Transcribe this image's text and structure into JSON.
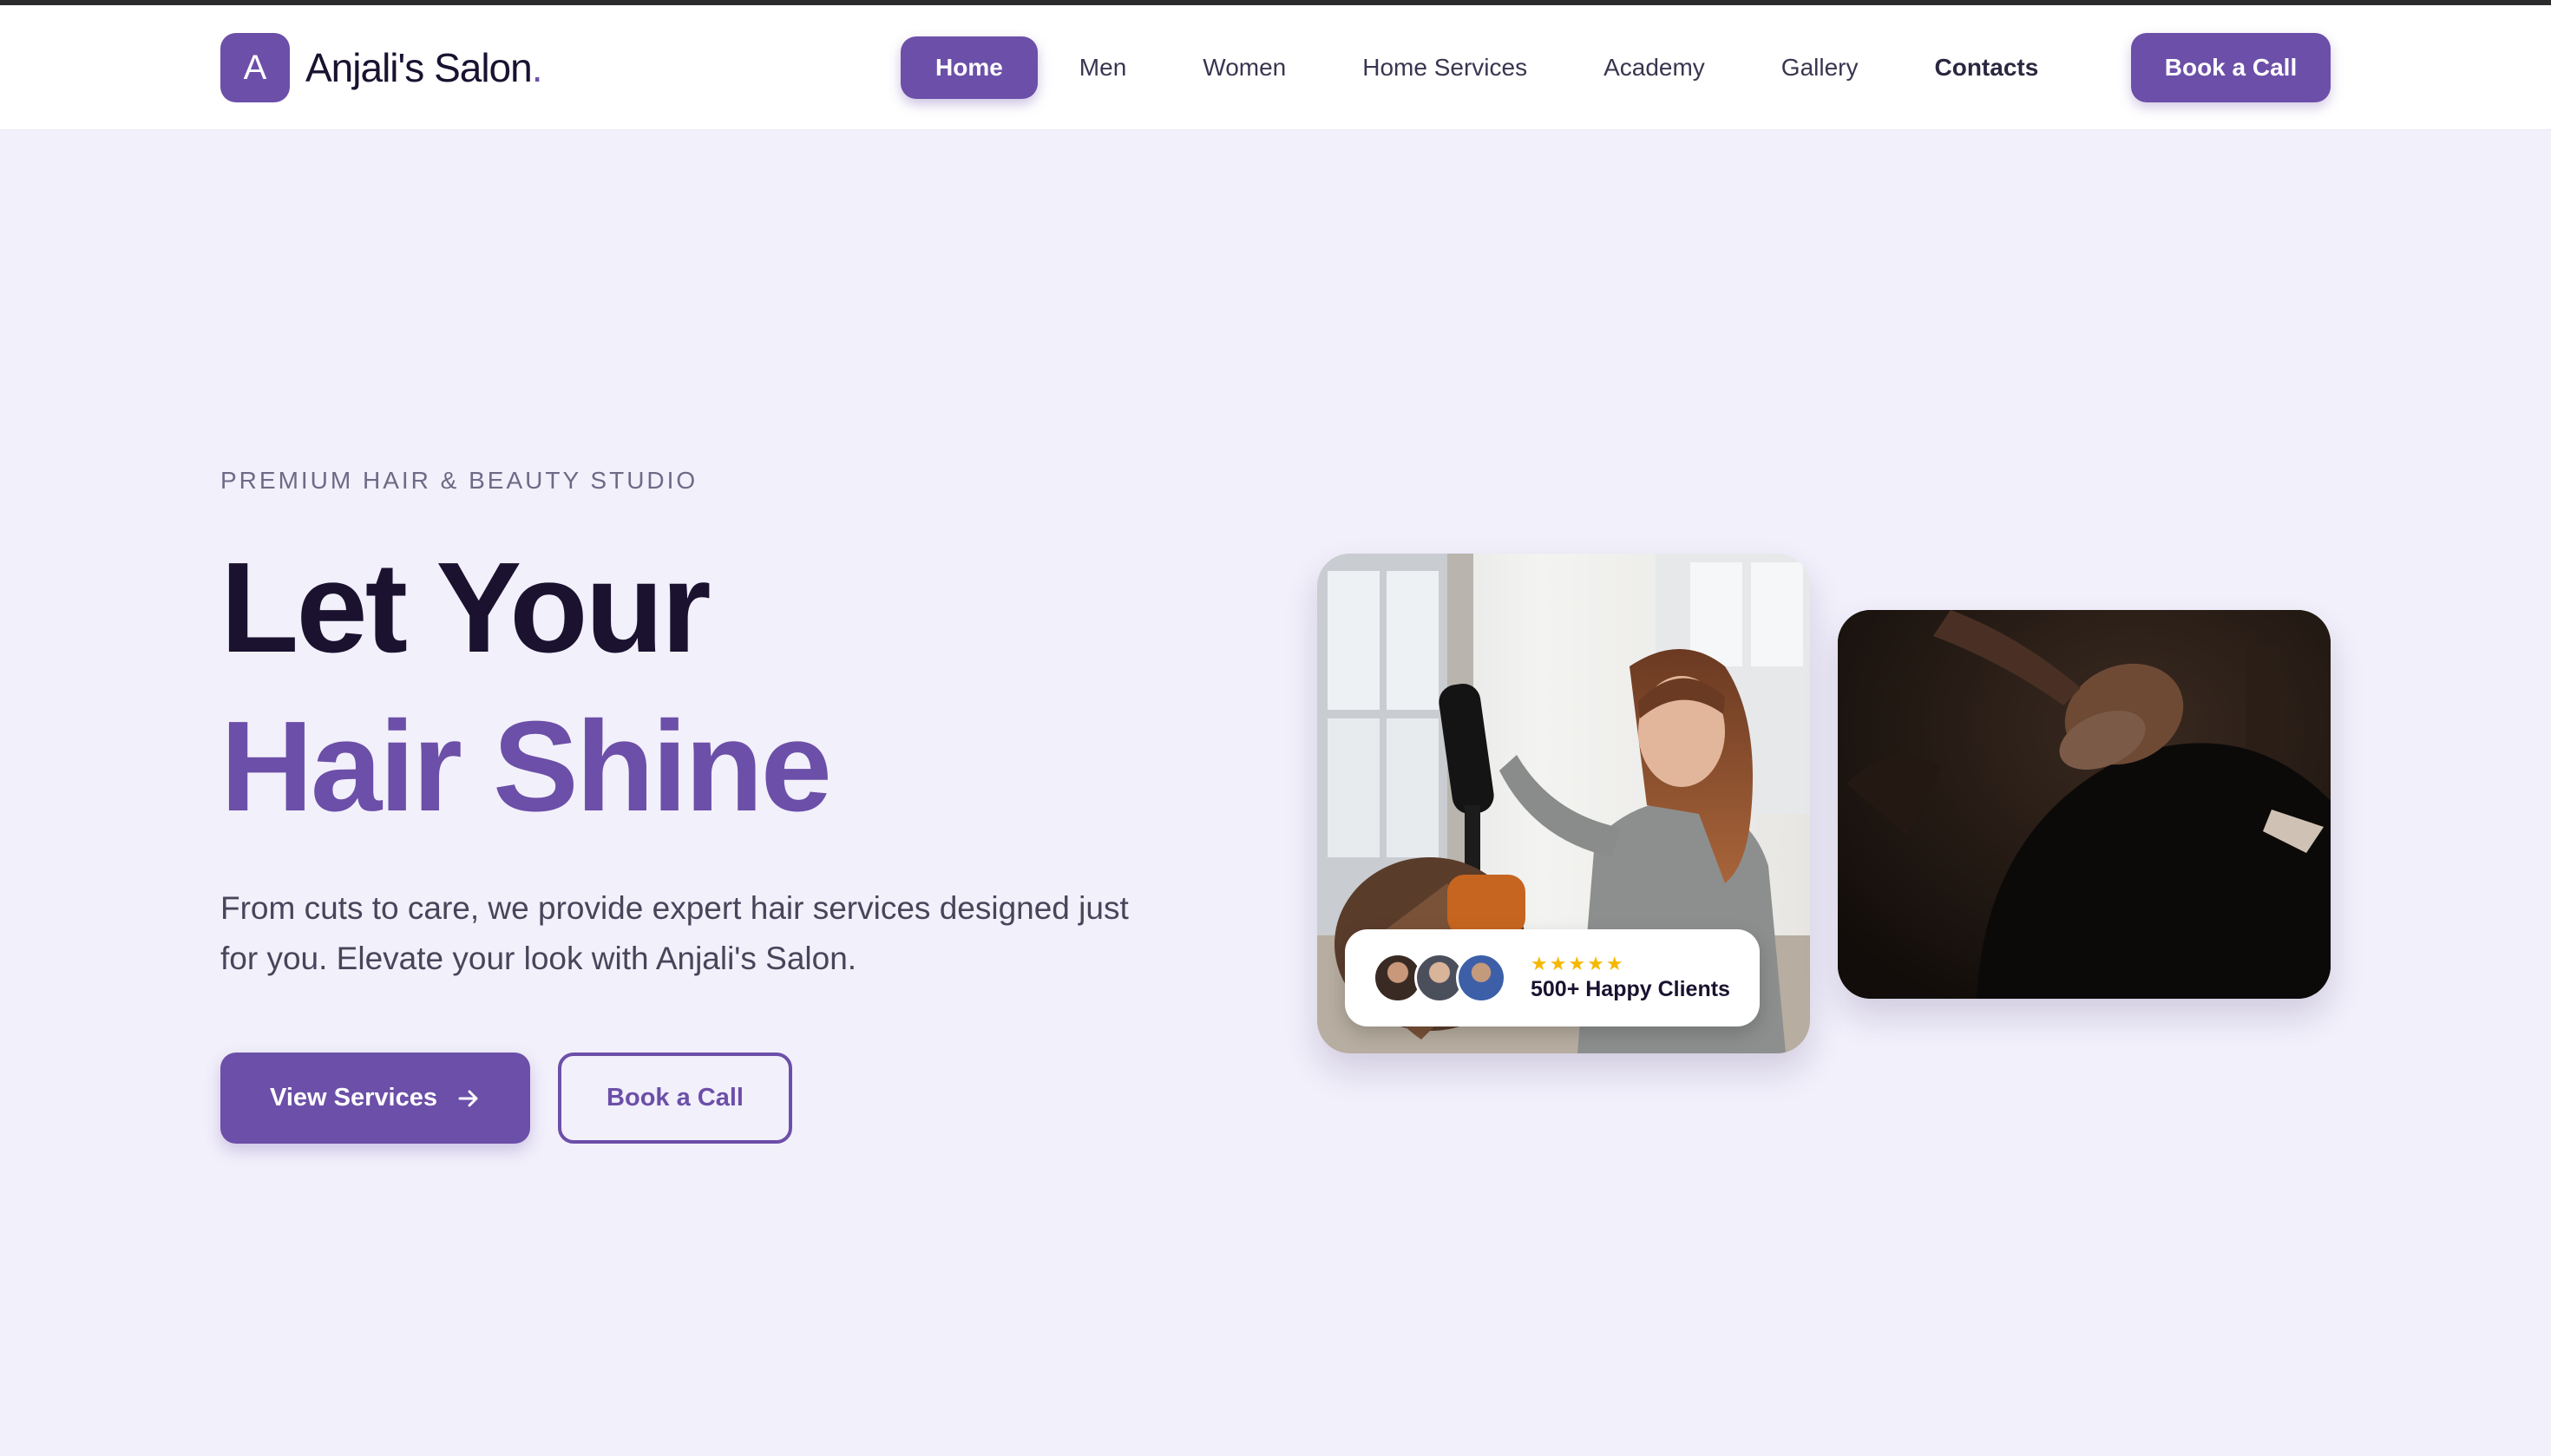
{
  "brand": {
    "logo_letter": "A",
    "name": "Anjali's Salon",
    "name_dot": ".",
    "accent_color": "#6c4fa8"
  },
  "nav": {
    "items": [
      {
        "label": "Home",
        "active": true
      },
      {
        "label": "Men"
      },
      {
        "label": "Women"
      },
      {
        "label": "Home Services"
      },
      {
        "label": "Academy"
      },
      {
        "label": "Gallery"
      },
      {
        "label": "Contacts"
      }
    ],
    "cta": "Book a Call"
  },
  "hero": {
    "eyebrow": "PREMIUM HAIR & BEAUTY STUDIO",
    "headline_line1": "Let Your",
    "headline_line2": "Hair Shine",
    "lead": "From cuts to care, we provide expert hair services designed just for you. Elevate your look with Anjali's Salon.",
    "primary_button": "View Services",
    "primary_button_icon": "arrow-right-icon",
    "secondary_button": "Book a Call"
  },
  "badge": {
    "stars": "★★★★★",
    "rating": 5,
    "label": "500+ Happy Clients"
  }
}
